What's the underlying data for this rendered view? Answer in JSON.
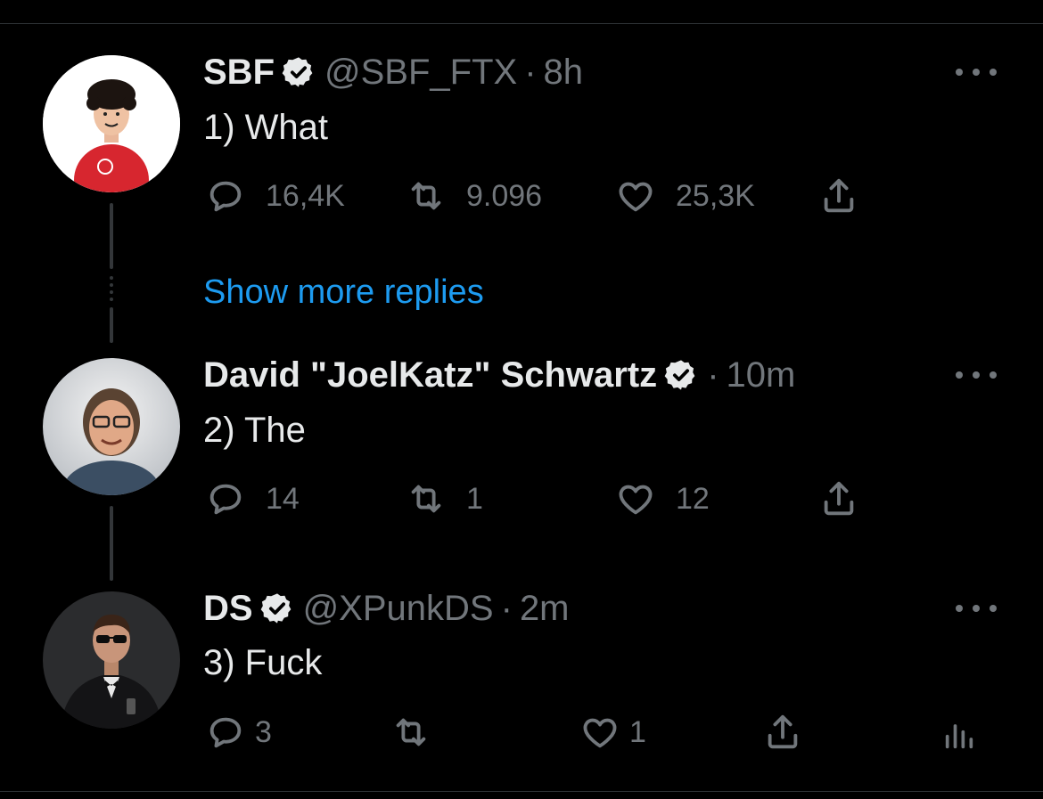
{
  "show_more_replies": "Show more replies",
  "tweets": [
    {
      "name": "SBF",
      "handle": "@SBF_FTX",
      "time": "8h",
      "text": "1) What",
      "replies": "16,4K",
      "retweets": "9.096",
      "likes": "25,3K",
      "avatar_icon": "avatar-cartoon-red-shirt"
    },
    {
      "name": "David \"JoelKatz\" Schwartz",
      "handle": "",
      "time": "10m",
      "text": "2) The",
      "replies": "14",
      "retweets": "1",
      "likes": "12",
      "avatar_icon": "avatar-man-glasses"
    },
    {
      "name": "DS",
      "handle": "@XPunkDS",
      "time": "2m",
      "text": "3) Fuck",
      "replies": "3",
      "retweets": "",
      "likes": "1",
      "avatar_icon": "avatar-man-tuxedo-sunglasses"
    }
  ],
  "colors": {
    "background": "#000000",
    "text": "#e7e9ea",
    "muted": "#71767b",
    "link": "#1d9bf0",
    "divider": "#2f3336"
  }
}
